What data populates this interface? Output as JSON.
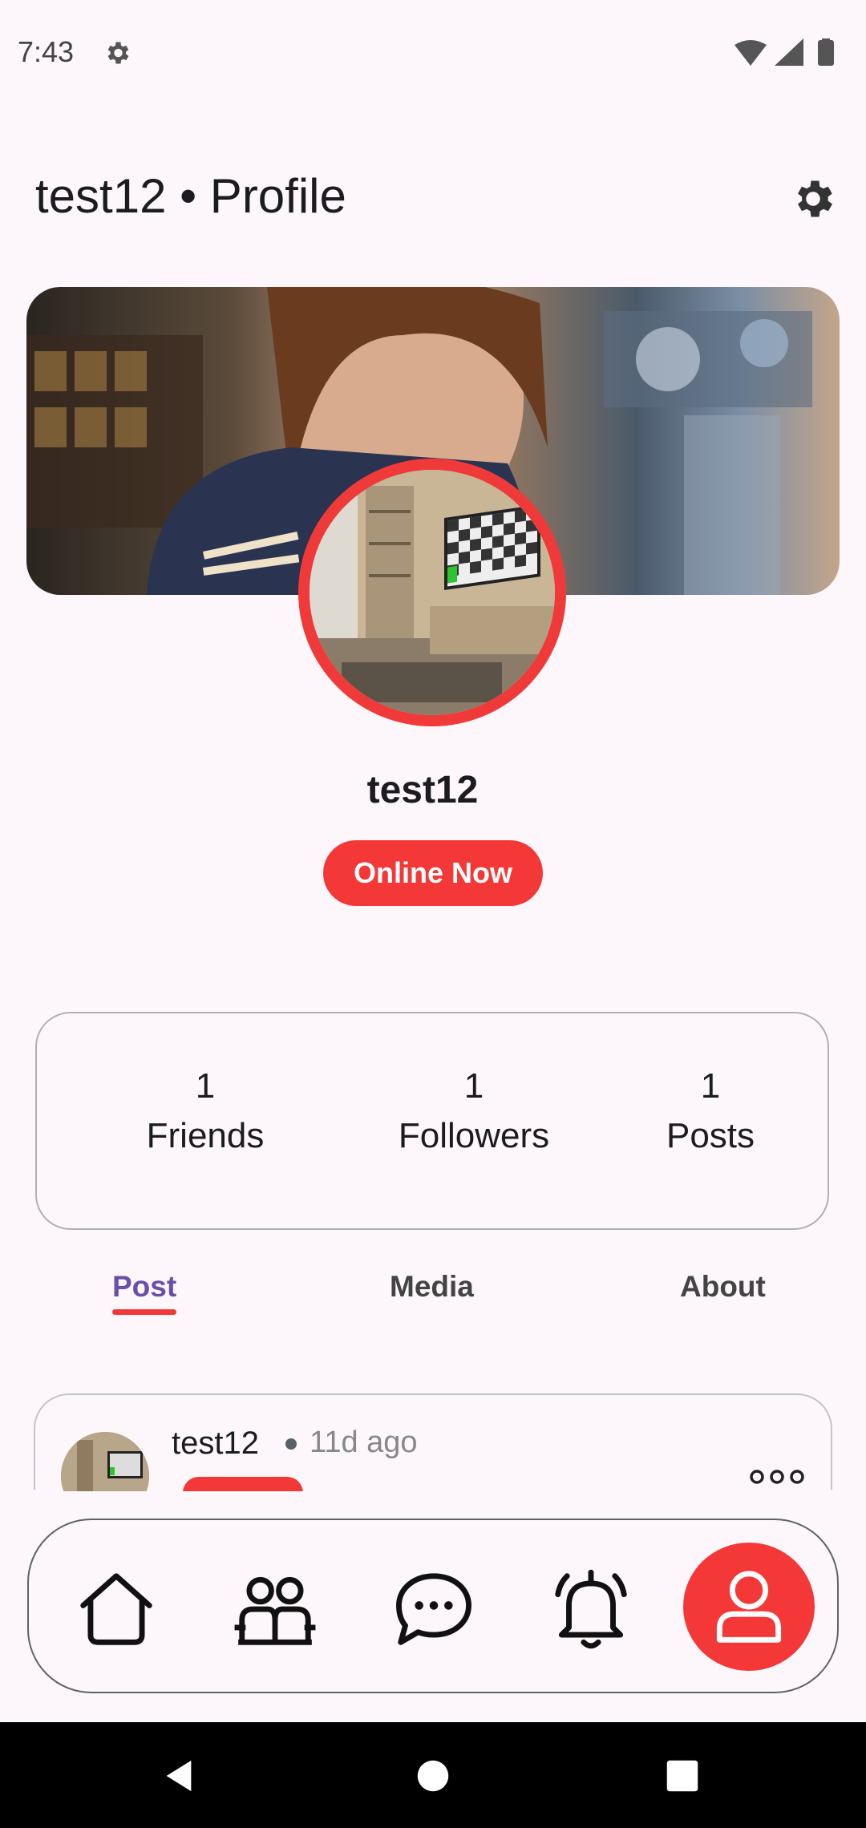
{
  "status_bar": {
    "time": "7:43"
  },
  "app_bar": {
    "title": "test12 • Profile"
  },
  "profile": {
    "username": "test12",
    "status_badge": "Online Now"
  },
  "stats": [
    {
      "value": "1",
      "label": "Friends"
    },
    {
      "value": "1",
      "label": "Followers"
    },
    {
      "value": "1",
      "label": "Posts"
    }
  ],
  "tabs": {
    "post": "Post",
    "media": "Media",
    "about": "About",
    "active": "Post"
  },
  "post": {
    "username": "test12",
    "time": "11d ago"
  },
  "colors": {
    "accent": "#f43838",
    "active_tab": "#6b4ea8"
  },
  "bottom_nav": [
    "home-icon",
    "friends-icon",
    "chat-icon",
    "notifications-icon",
    "profile-icon"
  ]
}
